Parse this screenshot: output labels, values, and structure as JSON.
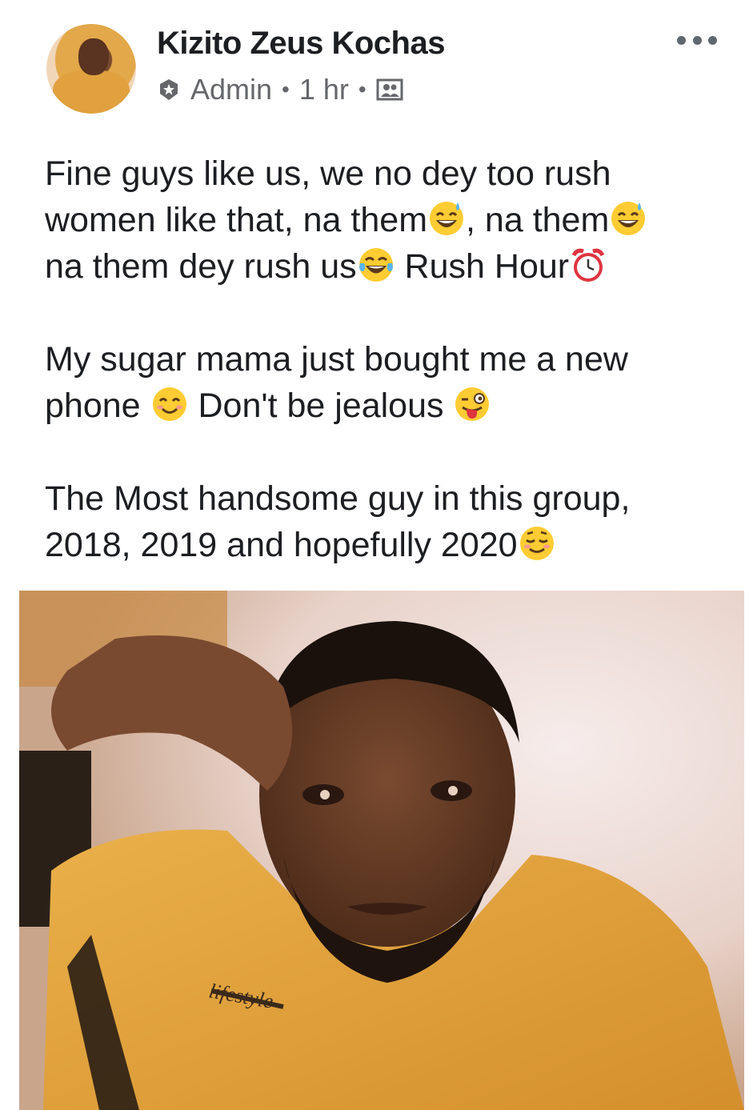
{
  "post": {
    "author": "Kizito Zeus Kochas",
    "role": "Admin",
    "time": "1 hr",
    "separator": "•",
    "audience_icon": "group-photo-icon",
    "badge_icon": "admin-badge-icon",
    "more_icon": "more-options-icon"
  },
  "body": {
    "paragraphs": [
      {
        "lines": [
          {
            "parts": [
              "Fine guys like us, we no dey too rush"
            ]
          },
          {
            "parts": [
              "women like that, na them",
              ", na them"
            ]
          },
          {
            "parts": [
              "na them dey rush us",
              "  Rush Hour"
            ]
          }
        ]
      },
      {
        "lines": [
          {
            "parts": [
              "My sugar mama just bought me a new"
            ]
          },
          {
            "parts": [
              "phone ",
              " Don't be jealous "
            ]
          }
        ]
      },
      {
        "lines": [
          {
            "parts": [
              "The Most handsome guy in this group,"
            ]
          },
          {
            "parts": [
              "2018, 2019 and hopefully 2020"
            ]
          }
        ]
      }
    ],
    "emojis": [
      "grinning-sweat-emoji",
      "tears-of-joy-emoji",
      "alarm-clock-emoji",
      "smiling-emoji",
      "winking-tongue-emoji",
      "relieved-smile-emoji"
    ]
  },
  "photo": {
    "description_icon": "post-photo",
    "shirt_text": "lifestyle"
  }
}
